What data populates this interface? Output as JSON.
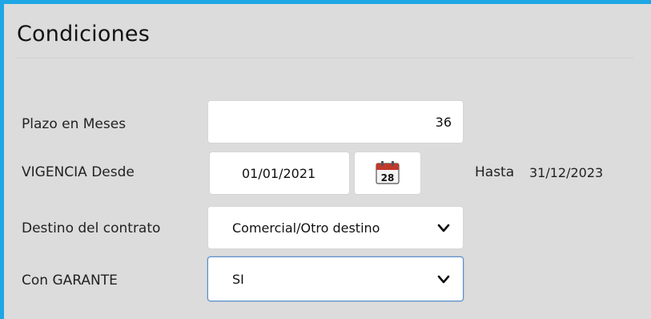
{
  "section": {
    "title": "Condiciones"
  },
  "fields": {
    "plazo": {
      "label": "Plazo en Meses",
      "value": "36"
    },
    "vigencia": {
      "label": "VIGENCIA Desde",
      "desde_value": "01/01/2021",
      "calendar_day": "28",
      "hasta_label": "Hasta",
      "hasta_value": "31/12/2023"
    },
    "destino": {
      "label": "Destino del contrato",
      "selected": "Comercial/Otro destino"
    },
    "garante": {
      "label": "Con GARANTE",
      "selected": "SI"
    }
  },
  "colors": {
    "accent": "#1ea7e4",
    "focus": "#5a8fc8",
    "calendar_red": "#c0392b"
  },
  "icons": {
    "calendar": "calendar-icon",
    "dropdown": "chevron-down-icon"
  }
}
